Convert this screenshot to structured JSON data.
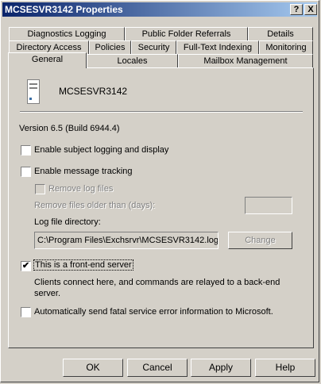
{
  "window": {
    "title": "MCSESVR3142 Properties",
    "help_button": "?",
    "close_button": "X"
  },
  "tabs": {
    "row1": [
      "Diagnostics Logging",
      "Public Folder Referrals",
      "Details"
    ],
    "row2": [
      "Directory Access",
      "Policies",
      "Security",
      "Full-Text Indexing",
      "Monitoring"
    ],
    "row3": [
      "General",
      "Locales",
      "Mailbox Management"
    ]
  },
  "general": {
    "server_name": "MCSESVR3142",
    "version": "Version 6.5 (Build 6944.4)",
    "subject_logging": {
      "label": "Enable subject logging and display",
      "checked": false
    },
    "message_tracking": {
      "label": "Enable message tracking",
      "checked": false
    },
    "remove_log_files": {
      "label": "Remove log files",
      "checked": false
    },
    "remove_older_label": "Remove files older than (days):",
    "remove_older_value": "",
    "log_dir_label": "Log file directory:",
    "log_dir_value": "C:\\Program Files\\Exchsrvr\\MCSESVR3142.log",
    "change_button": "Change",
    "front_end": {
      "label": "This is a front-end server",
      "checked": true
    },
    "front_end_desc_line1": "Clients connect here, and commands are relayed to a back-end",
    "front_end_desc_line2": "server.",
    "fatal_error": {
      "label": "Automatically send fatal service error information to Microsoft.",
      "checked": false
    }
  },
  "buttons": {
    "ok": "OK",
    "cancel": "Cancel",
    "apply": "Apply",
    "help": "Help"
  }
}
